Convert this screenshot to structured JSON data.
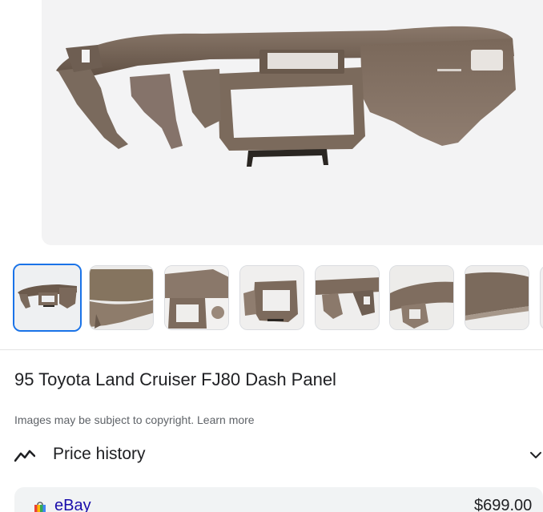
{
  "hero": {
    "source_label": "eBay"
  },
  "thumbnails": [
    {
      "name": "thumbnail-1",
      "selected": true
    },
    {
      "name": "thumbnail-2",
      "selected": false
    },
    {
      "name": "thumbnail-3",
      "selected": false
    },
    {
      "name": "thumbnail-4",
      "selected": false
    },
    {
      "name": "thumbnail-5",
      "selected": false
    },
    {
      "name": "thumbnail-6",
      "selected": false
    },
    {
      "name": "thumbnail-7",
      "selected": false
    }
  ],
  "product": {
    "title": "95 Toyota Land Cruiser FJ80 Dash Panel",
    "copyright_text": "Images may be subject to copyright.",
    "learn_more": "Learn more"
  },
  "price_history": {
    "label": "Price history",
    "icon": "trend-line-icon",
    "expand_icon": "chevron-down-icon"
  },
  "offer": {
    "store": "eBay",
    "price": "$699.00",
    "icon": "shopping-bag-icon"
  },
  "colors": {
    "accent": "#1a73e8",
    "link": "#1a0dab",
    "dash_brown": "#6b5a4c",
    "panel_bg": "#f1f3f4"
  }
}
